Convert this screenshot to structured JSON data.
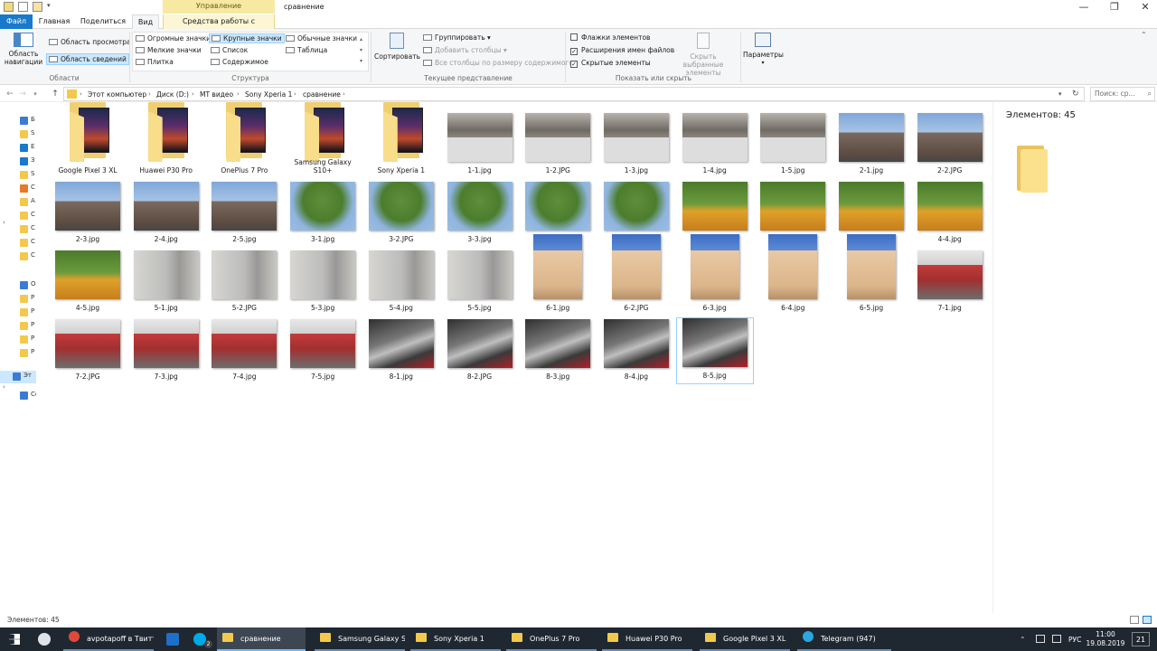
{
  "window": {
    "title": "сравнение",
    "ribbon_context": "Управление",
    "controls": [
      "—",
      "❐",
      "✕"
    ]
  },
  "ribbon_tabs": [
    {
      "label": "Файл"
    },
    {
      "label": "Главная"
    },
    {
      "label": "Поделиться"
    },
    {
      "label": "Вид"
    },
    {
      "label": "Средства работы с рисунками"
    }
  ],
  "ribbon": {
    "panes": {
      "nav_pane": "Область навигации",
      "preview": "Область просмотра",
      "details": "Область сведений",
      "group": "Области"
    },
    "layout": {
      "items": [
        "Огромные значки",
        "Крупные значки",
        "Обычные значки",
        "Мелкие значки",
        "Список",
        "Таблица",
        "Плитка",
        "Содержимое"
      ],
      "group": "Структура"
    },
    "current_view": {
      "sort": "Сортировать",
      "group_by": "Группировать",
      "add_columns": "Добавить столбцы",
      "fit_columns": "Все столбцы по размеру содержимого",
      "group": "Текущее представление"
    },
    "show_hide": {
      "checkboxes": [
        {
          "label": "Флажки элементов",
          "checked": false
        },
        {
          "label": "Расширения имен файлов",
          "checked": true
        },
        {
          "label": "Скрытые элементы",
          "checked": true
        }
      ],
      "hide_selected": "Скрыть выбранные элементы",
      "group": "Показать или скрыть"
    },
    "options": "Параметры"
  },
  "address": {
    "crumbs": [
      "Этот компьютер",
      "Диск (D:)",
      "MT видео",
      "Sony Xperia 1",
      "сравнение"
    ],
    "search_placeholder": "Поиск: ср..."
  },
  "navpane": {
    "items": [
      "Б",
      "S",
      "E",
      "З",
      "S",
      "C",
      "A",
      "C",
      "C",
      "C",
      "C",
      "O",
      "P",
      "P",
      "P",
      "P",
      "P",
      "Эт",
      "Се"
    ]
  },
  "files": [
    {
      "name": "Google Pixel 3 XL",
      "kind": "folder",
      "tone": "night"
    },
    {
      "name": "Huawei P30 Pro",
      "kind": "folder",
      "tone": "night"
    },
    {
      "name": "OnePlus 7 Pro",
      "kind": "folder",
      "tone": "night"
    },
    {
      "name": "Samsung Galaxy S10+",
      "kind": "folder",
      "tone": "night"
    },
    {
      "name": "Sony Xperia 1",
      "kind": "folder",
      "tone": "night"
    },
    {
      "name": "1-1.jpg",
      "kind": "image",
      "tone": "kid"
    },
    {
      "name": "1-2.JPG",
      "kind": "image",
      "tone": "kid"
    },
    {
      "name": "1-3.jpg",
      "kind": "image",
      "tone": "kid"
    },
    {
      "name": "1-4.jpg",
      "kind": "image",
      "tone": "kid"
    },
    {
      "name": "1-5.jpg",
      "kind": "image",
      "tone": "kid"
    },
    {
      "name": "2-1.jpg",
      "kind": "image",
      "tone": "building"
    },
    {
      "name": "2-2.JPG",
      "kind": "image",
      "tone": "building"
    },
    {
      "name": "2-3.jpg",
      "kind": "image",
      "tone": "building"
    },
    {
      "name": "2-4.jpg",
      "kind": "image",
      "tone": "building"
    },
    {
      "name": "2-5.jpg",
      "kind": "image",
      "tone": "building"
    },
    {
      "name": "3-1.jpg",
      "kind": "image",
      "tone": "tree"
    },
    {
      "name": "3-2.JPG",
      "kind": "image",
      "tone": "tree"
    },
    {
      "name": "3-3.jpg",
      "kind": "image",
      "tone": "tree"
    },
    {
      "name": "3-4.jpg",
      "kind": "image",
      "tone": "tree"
    },
    {
      "name": "3-5.jpg",
      "kind": "image",
      "tone": "tree"
    },
    {
      "name": "4-1.jpg",
      "kind": "image",
      "tone": "flowers"
    },
    {
      "name": "4-2.JPG",
      "kind": "image",
      "tone": "flowers"
    },
    {
      "name": "4-3.jpg",
      "kind": "image",
      "tone": "flowers"
    },
    {
      "name": "4-4.jpg",
      "kind": "image",
      "tone": "flowers"
    },
    {
      "name": "4-5.jpg",
      "kind": "image",
      "tone": "flowers"
    },
    {
      "name": "5-1.jpg",
      "kind": "image",
      "tone": "wall"
    },
    {
      "name": "5-2.JPG",
      "kind": "image",
      "tone": "wall"
    },
    {
      "name": "5-3.jpg",
      "kind": "image",
      "tone": "wall"
    },
    {
      "name": "5-4.jpg",
      "kind": "image",
      "tone": "wall"
    },
    {
      "name": "5-5.jpg",
      "kind": "image",
      "tone": "wall"
    },
    {
      "name": "6-1.jpg",
      "kind": "image",
      "tone": "church"
    },
    {
      "name": "6-2.JPG",
      "kind": "image",
      "tone": "church"
    },
    {
      "name": "6-3.jpg",
      "kind": "image",
      "tone": "church"
    },
    {
      "name": "6-4.jpg",
      "kind": "image",
      "tone": "church"
    },
    {
      "name": "6-5.jpg",
      "kind": "image",
      "tone": "church"
    },
    {
      "name": "7-1.jpg",
      "kind": "image",
      "tone": "store"
    },
    {
      "name": "7-2.JPG",
      "kind": "image",
      "tone": "store"
    },
    {
      "name": "7-3.jpg",
      "kind": "image",
      "tone": "store"
    },
    {
      "name": "7-4.jpg",
      "kind": "image",
      "tone": "store"
    },
    {
      "name": "7-5.jpg",
      "kind": "image",
      "tone": "store"
    },
    {
      "name": "8-1.jpg",
      "kind": "image",
      "tone": "ceiling"
    },
    {
      "name": "8-2.JPG",
      "kind": "image",
      "tone": "ceiling"
    },
    {
      "name": "8-3.jpg",
      "kind": "image",
      "tone": "ceiling"
    },
    {
      "name": "8-4.jpg",
      "kind": "image",
      "tone": "ceiling"
    },
    {
      "name": "8-5.jpg",
      "kind": "image",
      "tone": "ceiling",
      "selected": true
    }
  ],
  "details": {
    "count": "Элементов: 45"
  },
  "status": {
    "text": "Элементов: 45"
  },
  "taskbar": {
    "items": [
      {
        "label": "avpotapoff в Твитт...",
        "icon": "chrome-icon",
        "color": "#e0493a"
      },
      {
        "label": "сравнение",
        "icon": "folder-icon",
        "color": "#f2c94c",
        "active": true
      },
      {
        "label": "Samsung Galaxy S1...",
        "icon": "folder-icon",
        "color": "#f2c94c"
      },
      {
        "label": "Sony Xperia 1",
        "icon": "folder-icon",
        "color": "#f2c94c"
      },
      {
        "label": "OnePlus 7 Pro",
        "icon": "folder-icon",
        "color": "#f2c94c"
      },
      {
        "label": "Huawei P30 Pro",
        "icon": "folder-icon",
        "color": "#f2c94c"
      },
      {
        "label": "Google Pixel 3 XL",
        "icon": "folder-icon",
        "color": "#f2c94c"
      },
      {
        "label": "Telegram (947)",
        "icon": "telegram-icon",
        "color": "#2ca5e0"
      }
    ],
    "lang": "РУС",
    "time": "11:00",
    "date": "19.08.2019",
    "notifications": "21",
    "skype_badge": "2"
  }
}
